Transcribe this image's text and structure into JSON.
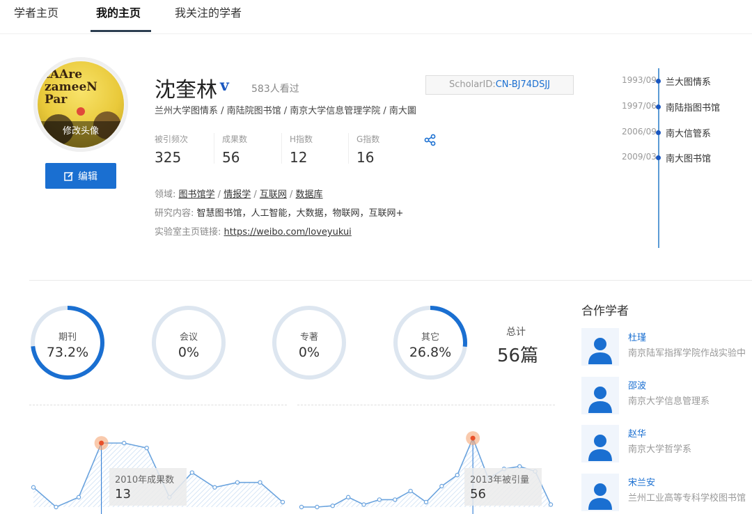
{
  "nav": {
    "tabs": [
      {
        "label": "学者主页"
      },
      {
        "label": "我的主页"
      },
      {
        "label": "我关注的学者"
      }
    ]
  },
  "avatar": {
    "caption": "修改头像",
    "poster_text": "tAAre zameeN Par"
  },
  "edit_button": {
    "label": "编辑"
  },
  "profile": {
    "name": "沈奎林",
    "verified_mark": "v",
    "views": "583人看过",
    "scholar_id_label": "ScholarID:",
    "scholar_id_value": "CN-BJ74DSJJ",
    "affiliation": "兰州大学图情系 / 南陆院图书馆 / 南京大学信息管理学院 / 南大圖"
  },
  "metrics": [
    {
      "label": "被引频次",
      "value": "325"
    },
    {
      "label": "成果数",
      "value": "56"
    },
    {
      "label": "H指数",
      "value": "12"
    },
    {
      "label": "G指数",
      "value": "16"
    }
  ],
  "info": {
    "field_label": "领域:",
    "fields": [
      "图书馆学",
      "情报学",
      "互联网",
      "数据库"
    ],
    "research_label": "研究内容:",
    "research_value": "智慧图书馆，人工智能，大数据，物联网，互联网+",
    "lab_label": "实验室主页链接:",
    "lab_link": "https://weibo.com/loveyukui"
  },
  "timeline": [
    {
      "date": "1993/09",
      "label": "兰大图情系"
    },
    {
      "date": "1997/06",
      "label": "南陆指图书馆"
    },
    {
      "date": "2006/09",
      "label": "南大信管系"
    },
    {
      "date": "2009/03",
      "label": "南大图书馆"
    }
  ],
  "rings": [
    {
      "label": "期刊",
      "value": "73.2%",
      "fraction": 0.732
    },
    {
      "label": "会议",
      "value": "0%",
      "fraction": 0
    },
    {
      "label": "专著",
      "value": "0%",
      "fraction": 0
    },
    {
      "label": "其它",
      "value": "26.8%",
      "fraction": 0.268
    }
  ],
  "total": {
    "label": "总计",
    "value": "56篇"
  },
  "charts": {
    "output": {
      "tooltip_title": "2010年成果数",
      "tooltip_value": "13",
      "values": [
        4,
        0,
        2,
        13,
        13,
        12,
        2,
        7,
        4,
        5,
        5,
        1
      ],
      "highlight_index": 3,
      "ymax": 15
    },
    "citations": {
      "tooltip_title": "2013年被引量",
      "tooltip_value": "56",
      "values": [
        0,
        0,
        1,
        8,
        2,
        6,
        6,
        13,
        4,
        17,
        26,
        56,
        23,
        31,
        33,
        29,
        2
      ],
      "highlight_index": 11,
      "ymax": 60
    }
  },
  "coauthors": {
    "title": "合作学者",
    "items": [
      {
        "name": "杜瑾",
        "affiliation": "南京陆军指挥学院作战实验中"
      },
      {
        "name": "邵波",
        "affiliation": "南京大学信息管理系"
      },
      {
        "name": "赵华",
        "affiliation": "南京大学哲学系"
      },
      {
        "name": "宋兰安",
        "affiliation": "兰州工业高等专科学校图书馆"
      }
    ]
  },
  "colors": {
    "accent": "#1a6fd1",
    "ring_track": "#dde6f0",
    "ring_fill": "#1a6fd1",
    "line": "#6aa3de",
    "highlight": "#f5a676"
  }
}
